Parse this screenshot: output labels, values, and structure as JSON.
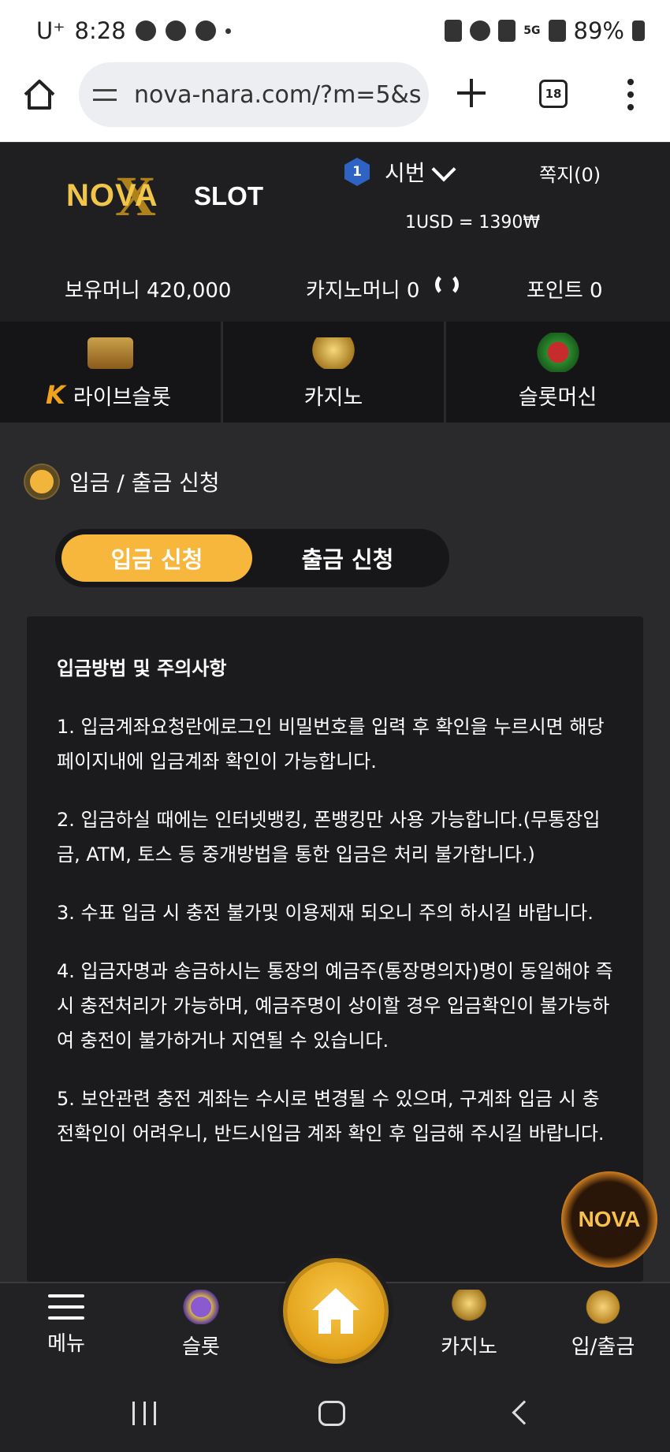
{
  "status_bar": {
    "carrier": "U⁺",
    "time": "8:28",
    "network": "5G",
    "battery": "89%"
  },
  "browser": {
    "url": "nova-nara.com/?m=5&s",
    "tab_count": "18"
  },
  "header": {
    "logo_text_nova": "NOVA",
    "logo_text_slot": "SLOT",
    "level": "1",
    "username": "시번",
    "message": "쪽지(0)",
    "exchange_rate": "1USD = 1390₩"
  },
  "balance": {
    "money": "보유머니 420,000",
    "casino_money": "카지노머니 0",
    "point": "포인트 0"
  },
  "game_nav": [
    {
      "label": "라이브슬롯",
      "icon": "live-slot-icon"
    },
    {
      "label": "카지노",
      "icon": "k-slot-casino-icon"
    },
    {
      "label": "슬롯머신",
      "icon": "slot-777-icon"
    }
  ],
  "section": {
    "title": "입금 / 출금 신청",
    "tab_deposit": "입금 신청",
    "tab_withdraw": "출금 신청"
  },
  "notice": {
    "heading": "입금방법 및 주의사항",
    "items": [
      "1. 입금계좌요청란에로그인 비밀번호를 입력 후 확인을 누르시면 해당 페이지내에 입금계좌 확인이 가능합니다.",
      "2. 입금하실 때에는 인터넷뱅킹, 폰뱅킹만 사용 가능합니다.(무통장입금, ATM, 토스 등 중개방법을 통한 입금은 처리 불가합니다.)",
      "3. 수표 입금 시 충전 불가및 이용제재 되오니 주의 하시길 바랍니다.",
      "4. 입금자명과 송금하시는 통장의 예금주(통장명의자)명이 동일해야 즉시 충전처리가 가능하며, 예금주명이 상이할 경우 입금확인이 불가능하여 충전이 불가하거나 지연될 수 있습니다.",
      "5. 보안관련 충전 계좌는 수시로 변경될 수 있으며, 구계좌 입금 시 충전확인이 어려우니, 반드시입금 계좌 확인 후 입금해 주시길 바랍니다."
    ]
  },
  "float_logo": "NOVA",
  "bottom_nav": {
    "menu": "메뉴",
    "slot": "슬롯",
    "casino": "카지노",
    "deposit_withdraw": "입/출금"
  },
  "colors": {
    "accent": "#f6b73c",
    "background": "#2a2a2c",
    "panel": "#1b1b1d"
  }
}
